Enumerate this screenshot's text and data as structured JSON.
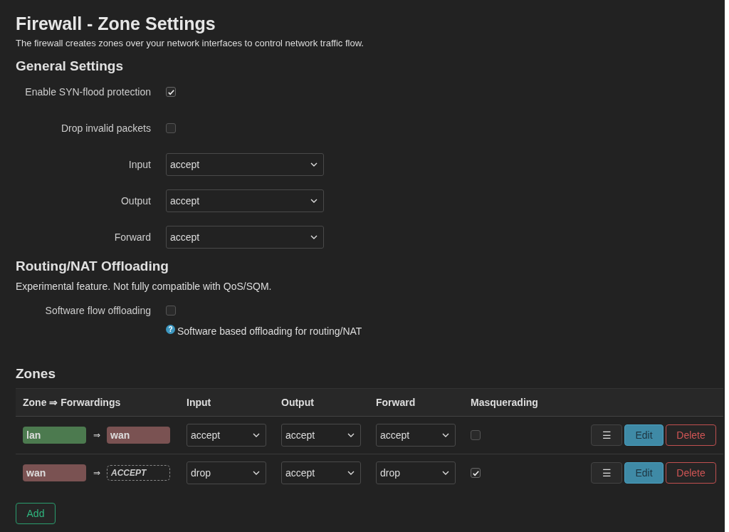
{
  "title": "Firewall - Zone Settings",
  "description": "The firewall creates zones over your network interfaces to control network traffic flow.",
  "general": {
    "heading": "General Settings",
    "fields": [
      {
        "kind": "checkbox",
        "label": "Enable SYN-flood protection",
        "checked": true
      },
      {
        "kind": "checkbox",
        "label": "Drop invalid packets",
        "checked": false
      },
      {
        "kind": "select",
        "label": "Input",
        "value": "accept"
      },
      {
        "kind": "select",
        "label": "Output",
        "value": "accept"
      },
      {
        "kind": "select",
        "label": "Forward",
        "value": "accept"
      }
    ]
  },
  "offloading": {
    "heading": "Routing/NAT Offloading",
    "description": "Experimental feature. Not fully compatible with QoS/SQM.",
    "field": {
      "label": "Software flow offloading",
      "checked": false
    },
    "help_glyph": "?",
    "help": "Software based offloading for routing/NAT"
  },
  "zones": {
    "heading": "Zones",
    "columns": [
      "Zone ⇒ Forwardings",
      "Input",
      "Output",
      "Forward",
      "Masquerading"
    ],
    "rows": [
      {
        "zone": {
          "name": "lan",
          "color": "#4c7a4f"
        },
        "arrow": "⇒",
        "forward": {
          "kind": "zone",
          "name": "wan",
          "color": "#7a5252"
        },
        "input": "accept",
        "output": "accept",
        "forward_policy": "accept",
        "masquerading": false,
        "menu": "☰",
        "edit": "Edit",
        "delete": "Delete"
      },
      {
        "zone": {
          "name": "wan",
          "color": "#7a5252"
        },
        "arrow": "⇒",
        "forward": {
          "kind": "policy",
          "name": "ACCEPT"
        },
        "input": "drop",
        "output": "accept",
        "forward_policy": "drop",
        "masquerading": true,
        "menu": "☰",
        "edit": "Edit",
        "delete": "Delete"
      }
    ],
    "add": "Add"
  }
}
